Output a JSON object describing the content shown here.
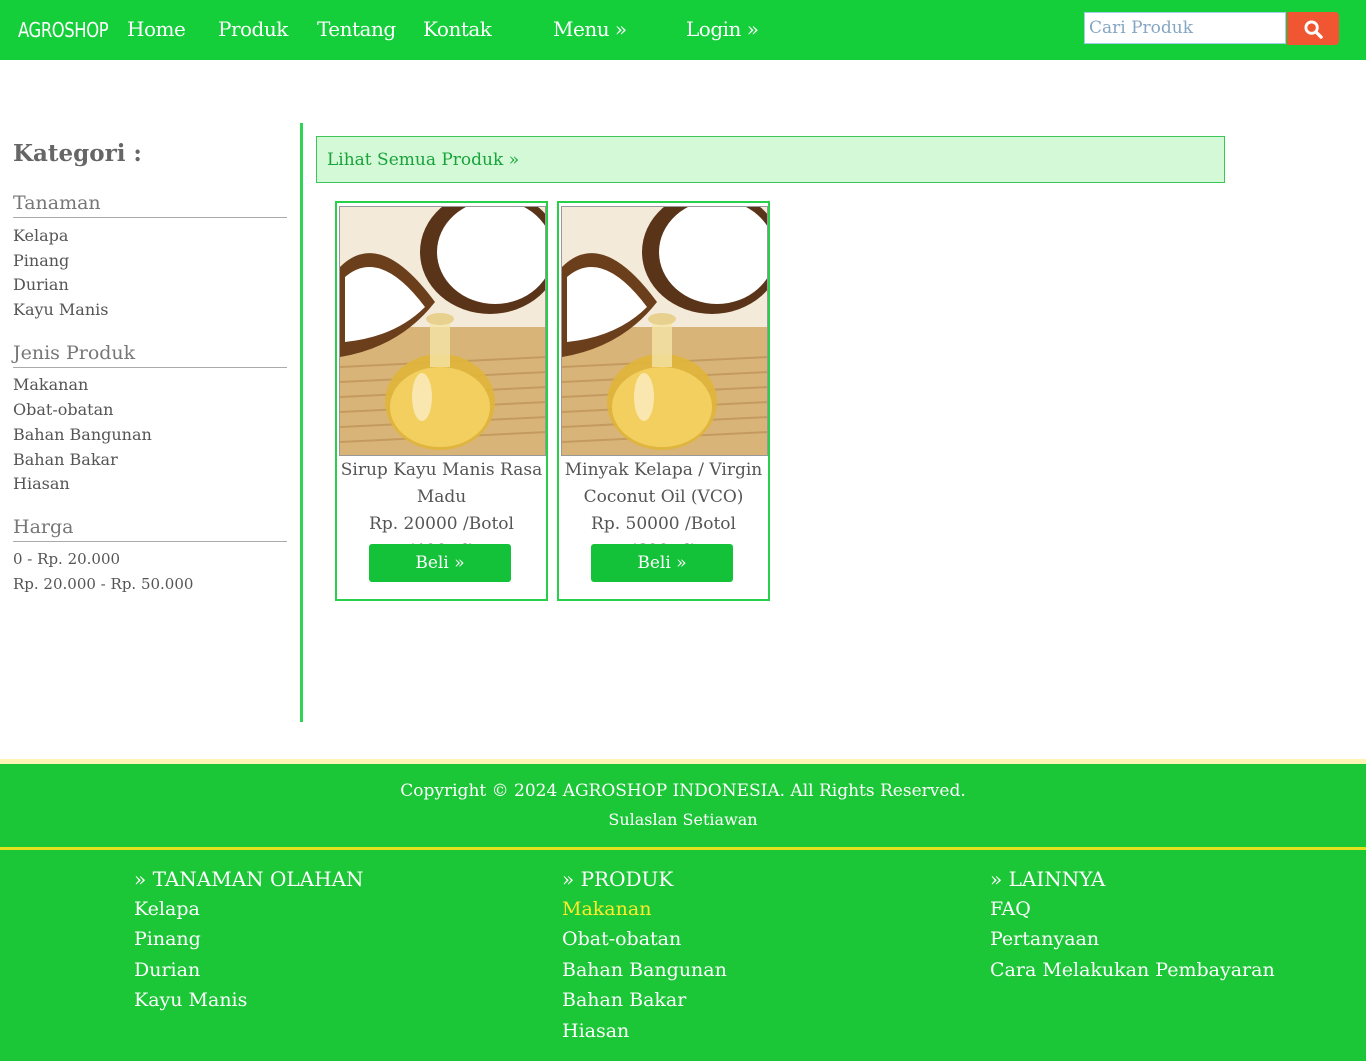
{
  "header": {
    "logo": "AGROSHOP",
    "nav": [
      "Home",
      "Produk",
      "Tentang",
      "Kontak",
      "Menu »",
      "Login »"
    ],
    "search_placeholder": "Cari Produk",
    "accent_color": "#14cf3a",
    "search_button_color": "#ef5631"
  },
  "sidebar": {
    "heading": "Kategori :",
    "sections": [
      {
        "title": "Tanaman",
        "items": [
          "Kelapa",
          "Pinang",
          "Durian",
          "Kayu Manis"
        ]
      },
      {
        "title": "Jenis Produk",
        "items": [
          "Makanan",
          "Obat-obatan",
          "Bahan Bangunan",
          "Bahan Bakar",
          "Hiasan"
        ]
      },
      {
        "title": "Harga",
        "items": [
          "0 - Rp. 20.000",
          "Rp. 20.000 - Rp. 50.000"
        ]
      }
    ]
  },
  "main": {
    "banner_link": "Lihat Semua Produk »",
    "products": [
      {
        "name": "Sirup Kayu Manis Rasa Madu",
        "price": "Rp. 20000 /Botol (400ml)",
        "button": "Beli »",
        "image_icon": "coconut-oil-photo"
      },
      {
        "name": "Minyak Kelapa / Virgin Coconut Oil (VCO)",
        "price": "Rp. 50000 /Botol (600ml)",
        "button": "Beli »",
        "image_icon": "coconut-oil-photo"
      }
    ]
  },
  "footer": {
    "copyright": "Copyright © 2024 AGROSHOP INDONESIA. All Rights Reserved.",
    "author": "Sulaslan Setiawan",
    "columns": [
      {
        "title": "» TANAMAN OLAHAN",
        "items": [
          "Kelapa",
          "Pinang",
          "Durian",
          "Kayu Manis"
        ]
      },
      {
        "title": "» PRODUK",
        "items": [
          "Makanan",
          "Obat-obatan",
          "Bahan Bangunan",
          "Bahan Bakar",
          "Hiasan"
        ],
        "active": "Makanan"
      },
      {
        "title": "» LAINNYA",
        "items": [
          "FAQ",
          "Pertanyaan",
          "Cara Melakukan Pembayaran"
        ]
      }
    ]
  }
}
